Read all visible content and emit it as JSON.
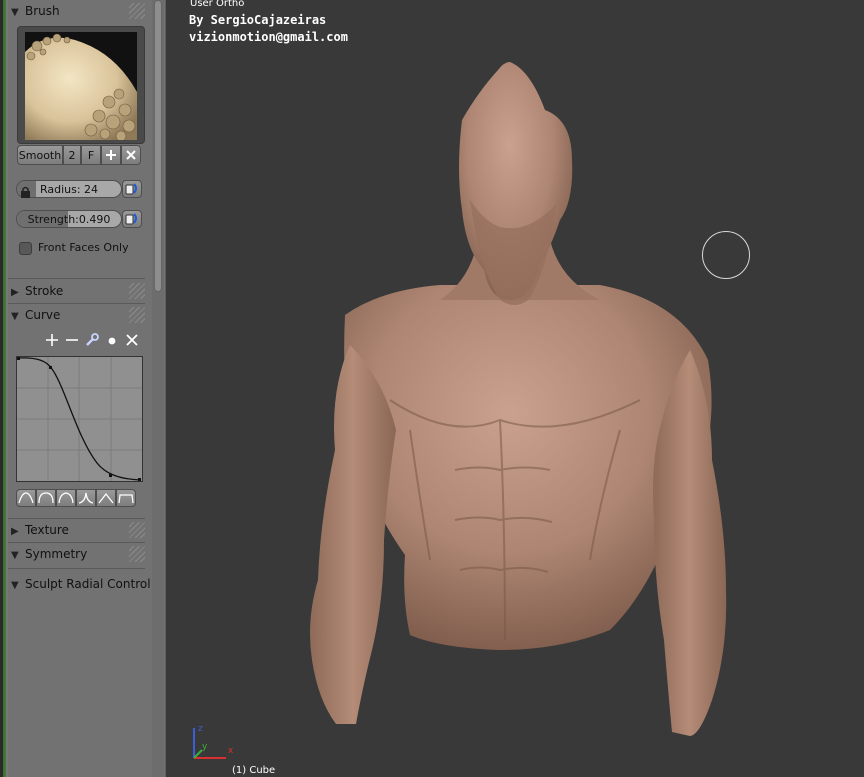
{
  "panel": {
    "brush": {
      "header": "Brush",
      "name": "Smooth",
      "users": "2",
      "fake_user": "F",
      "radius_label": "Radius: 24",
      "radius_fraction": 0.18,
      "strength_prefix": "Strength: ",
      "strength_value": "0.490",
      "strength_fraction": 0.49,
      "front_faces_label": "Front Faces Only",
      "front_faces_checked": false
    },
    "sections": {
      "stroke": "Stroke",
      "curve": "Curve",
      "texture": "Texture",
      "symmetry": "Symmetry",
      "radial": "Sculpt Radial Control"
    }
  },
  "viewport": {
    "view_name": "User Ortho",
    "credit_line1": "By SergioCajazeiras",
    "credit_line2": "vizionmotion@gmail.com",
    "object_label": "(1) Cube",
    "axis_x": "x",
    "axis_y": "y",
    "axis_z": "z"
  },
  "colors": {
    "panel_bg": "#727272",
    "viewport_bg": "#393939",
    "clay": "#ad8572"
  }
}
